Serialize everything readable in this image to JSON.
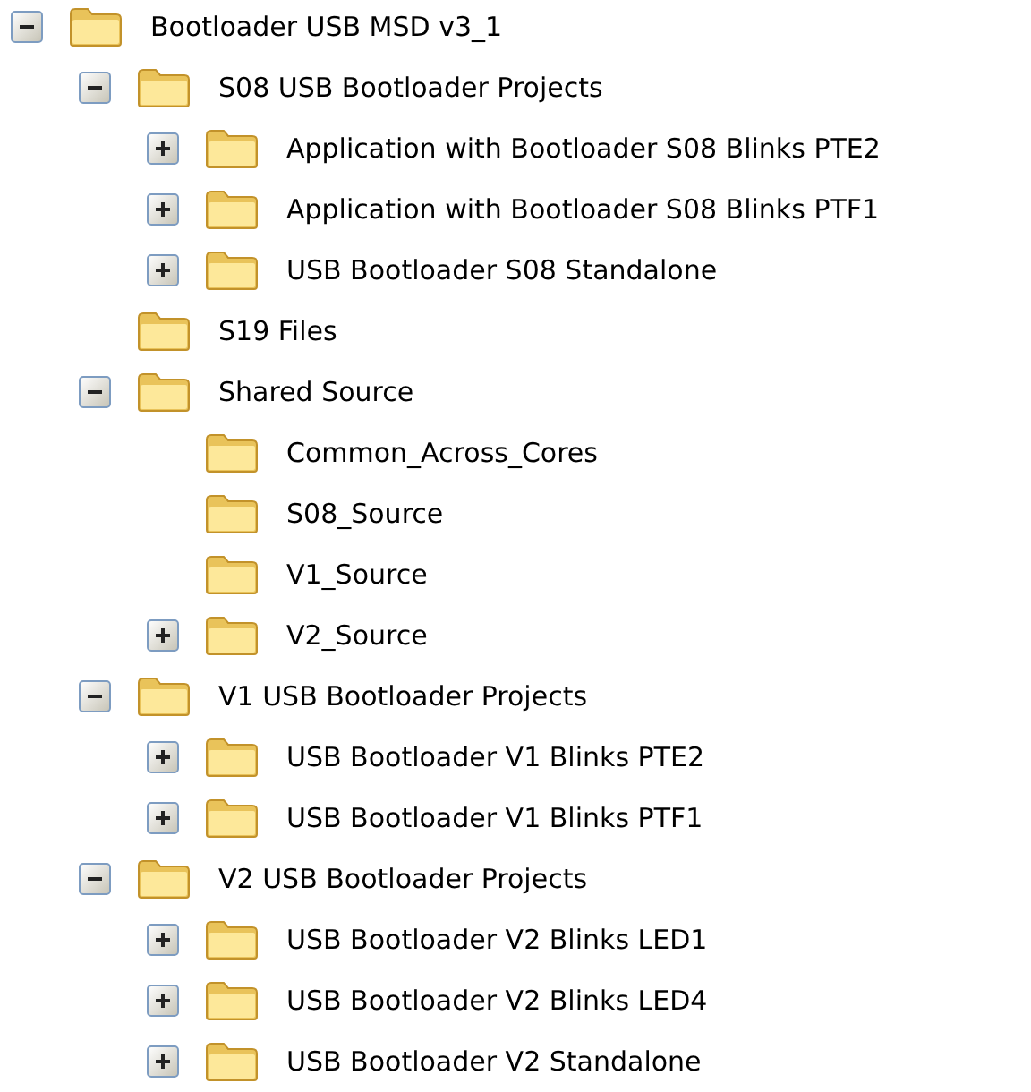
{
  "tree": [
    {
      "label": "Bootloader USB MSD v3_1",
      "expanded": true,
      "children": [
        {
          "label": "S08 USB Bootloader Projects",
          "expanded": true,
          "children": [
            {
              "label": "Application with Bootloader S08 Blinks PTE2",
              "expanded": false
            },
            {
              "label": "Application with Bootloader S08 Blinks PTF1",
              "expanded": false
            },
            {
              "label": "USB Bootloader S08 Standalone",
              "expanded": false
            }
          ]
        },
        {
          "label": "S19 Files"
        },
        {
          "label": "Shared Source",
          "expanded": true,
          "children": [
            {
              "label": "Common_Across_Cores"
            },
            {
              "label": "S08_Source"
            },
            {
              "label": "V1_Source"
            },
            {
              "label": "V2_Source",
              "expanded": false
            }
          ]
        },
        {
          "label": "V1 USB Bootloader Projects",
          "expanded": true,
          "children": [
            {
              "label": "USB Bootloader V1 Blinks PTE2",
              "expanded": false
            },
            {
              "label": "USB Bootloader V1 Blinks PTF1",
              "expanded": false
            }
          ]
        },
        {
          "label": "V2 USB Bootloader Projects",
          "expanded": true,
          "children": [
            {
              "label": "USB Bootloader V2 Blinks LED1",
              "expanded": false
            },
            {
              "label": "USB Bootloader V2 Blinks LED4",
              "expanded": false
            },
            {
              "label": "USB Bootloader V2 Standalone",
              "expanded": false
            }
          ]
        }
      ]
    }
  ]
}
